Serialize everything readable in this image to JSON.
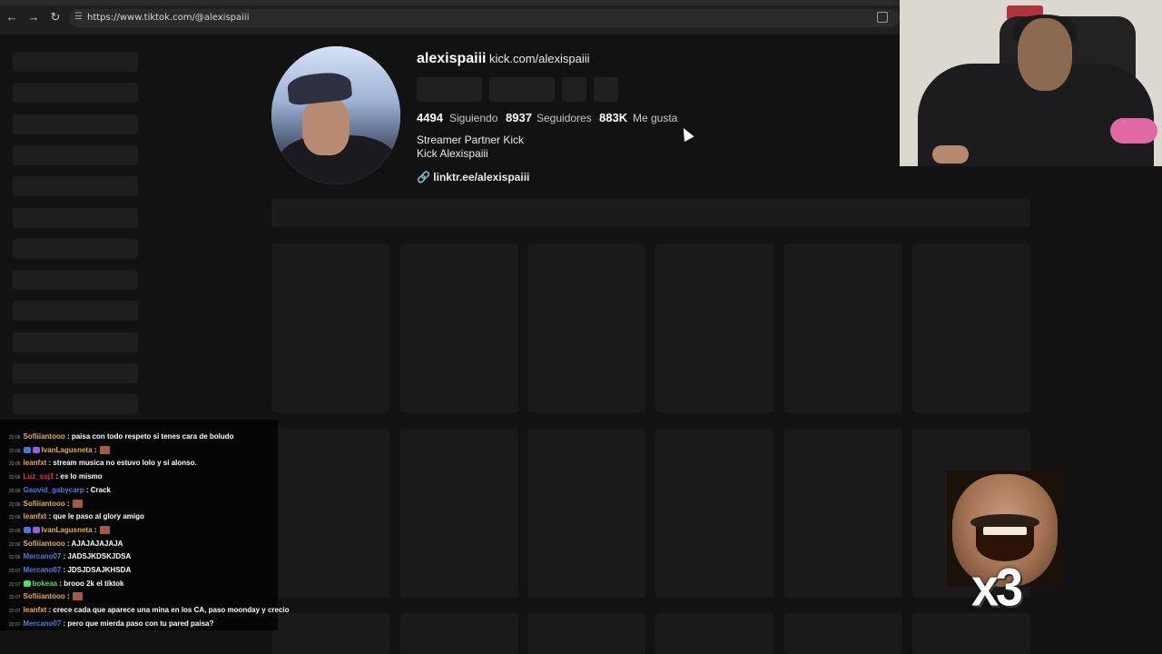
{
  "browser": {
    "url": "https://www.tiktok.com/@alexispaiii"
  },
  "profile": {
    "username": "alexispaiii",
    "nickname": "kick.com/alexispaiii",
    "stats": [
      {
        "value": "4494",
        "label": "Siguiendo"
      },
      {
        "value": "8937",
        "label": "Seguidores"
      },
      {
        "value": "883K",
        "label": "Me gusta"
      }
    ],
    "bio_lines": [
      "Streamer Partner Kick",
      "Kick Alexispaiii"
    ],
    "link": "linktr.ee/alexispaiii"
  },
  "chat": {
    "messages": [
      {
        "time": "22:06",
        "user": "Sofiiiantooo",
        "user_color": "#e8b04a",
        "badges": [],
        "text": "paisa con todo respeto si tenes cara de boludo",
        "emote": false
      },
      {
        "time": "22:06",
        "user": "IvanLagusneta",
        "user_color": "#e8b04a",
        "badges": [
          "#3d7bd6",
          "#9a5ce0"
        ],
        "text": "",
        "emote": true
      },
      {
        "time": "22:06",
        "user": "leanfxt",
        "user_color": "#e8b04a",
        "badges": [],
        "text": "stream musica no estuvo lolo y si alonso.",
        "emote": false
      },
      {
        "time": "22:06",
        "user": "Luz_ssj1",
        "user_color": "#e0394a",
        "badges": [],
        "text": "es lo mismo",
        "emote": false
      },
      {
        "time": "22:06",
        "user": "Gauvid_gabycarp",
        "user_color": "#4c7fe0",
        "badges": [],
        "text": "Crack",
        "emote": false
      },
      {
        "time": "22:06",
        "user": "Sofiiiantooo",
        "user_color": "#e8b04a",
        "badges": [],
        "text": "",
        "emote": true
      },
      {
        "time": "22:06",
        "user": "leanfxt",
        "user_color": "#e8b04a",
        "badges": [],
        "text": "que le paso al glory amigo",
        "emote": false
      },
      {
        "time": "22:06",
        "user": "IvanLagusneta",
        "user_color": "#e8b04a",
        "badges": [
          "#3d7bd6",
          "#9a5ce0"
        ],
        "text": "",
        "emote": true
      },
      {
        "time": "22:06",
        "user": "Sofiiiantooo",
        "user_color": "#e8b04a",
        "badges": [],
        "text": "AJAJAJAJAJA",
        "emote": false
      },
      {
        "time": "22:06",
        "user": "Mercano07",
        "user_color": "#4c7fe0",
        "badges": [],
        "text": "JADSJKDSKJDSA",
        "emote": false
      },
      {
        "time": "22:07",
        "user": "Mercano07",
        "user_color": "#4c7fe0",
        "badges": [],
        "text": "JDSJDSAJKHSDA",
        "emote": false
      },
      {
        "time": "22:07",
        "user": "bokeaa",
        "user_color": "#4ce06a",
        "badges": [
          "#4ce06a"
        ],
        "text": "brooo 2k el tiktok",
        "emote": false
      },
      {
        "time": "22:07",
        "user": "Sofiiiantooo",
        "user_color": "#e8b04a",
        "badges": [],
        "text": "",
        "emote": true
      },
      {
        "time": "22:07",
        "user": "leanfxt",
        "user_color": "#e8b04a",
        "badges": [],
        "text": "crece cada que aparece una mina en los CA, paso moonday y crecio",
        "emote": false
      },
      {
        "time": "22:07",
        "user": "Mercano07",
        "user_color": "#4c7fe0",
        "badges": [],
        "text": "pero que mierda paso con tu pared paisa?",
        "emote": false
      }
    ]
  },
  "overlay": {
    "meme_count": "x3"
  }
}
